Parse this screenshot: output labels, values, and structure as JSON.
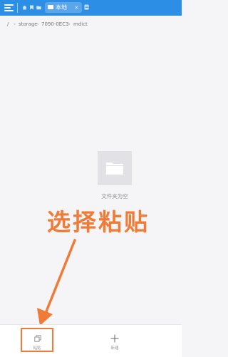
{
  "topbar": {
    "tab_label": "本地",
    "tab_close": "×"
  },
  "breadcrumb": {
    "root": "/",
    "items": [
      "storage",
      "7090-0EC3",
      "mdict"
    ]
  },
  "empty_state": {
    "message": "文件夹为空"
  },
  "annotation": {
    "text": "选择粘贴"
  },
  "bottombar": {
    "paste_label": "粘贴",
    "new_label": "新建"
  },
  "colors": {
    "accent_blue": "#2d8ee6",
    "annotation_orange": "#f07b36"
  },
  "icons": [
    "menu-icon",
    "home-icon",
    "bookmark-icon",
    "folder-icon",
    "close-icon",
    "document-icon",
    "paste-icon",
    "plus-icon"
  ]
}
